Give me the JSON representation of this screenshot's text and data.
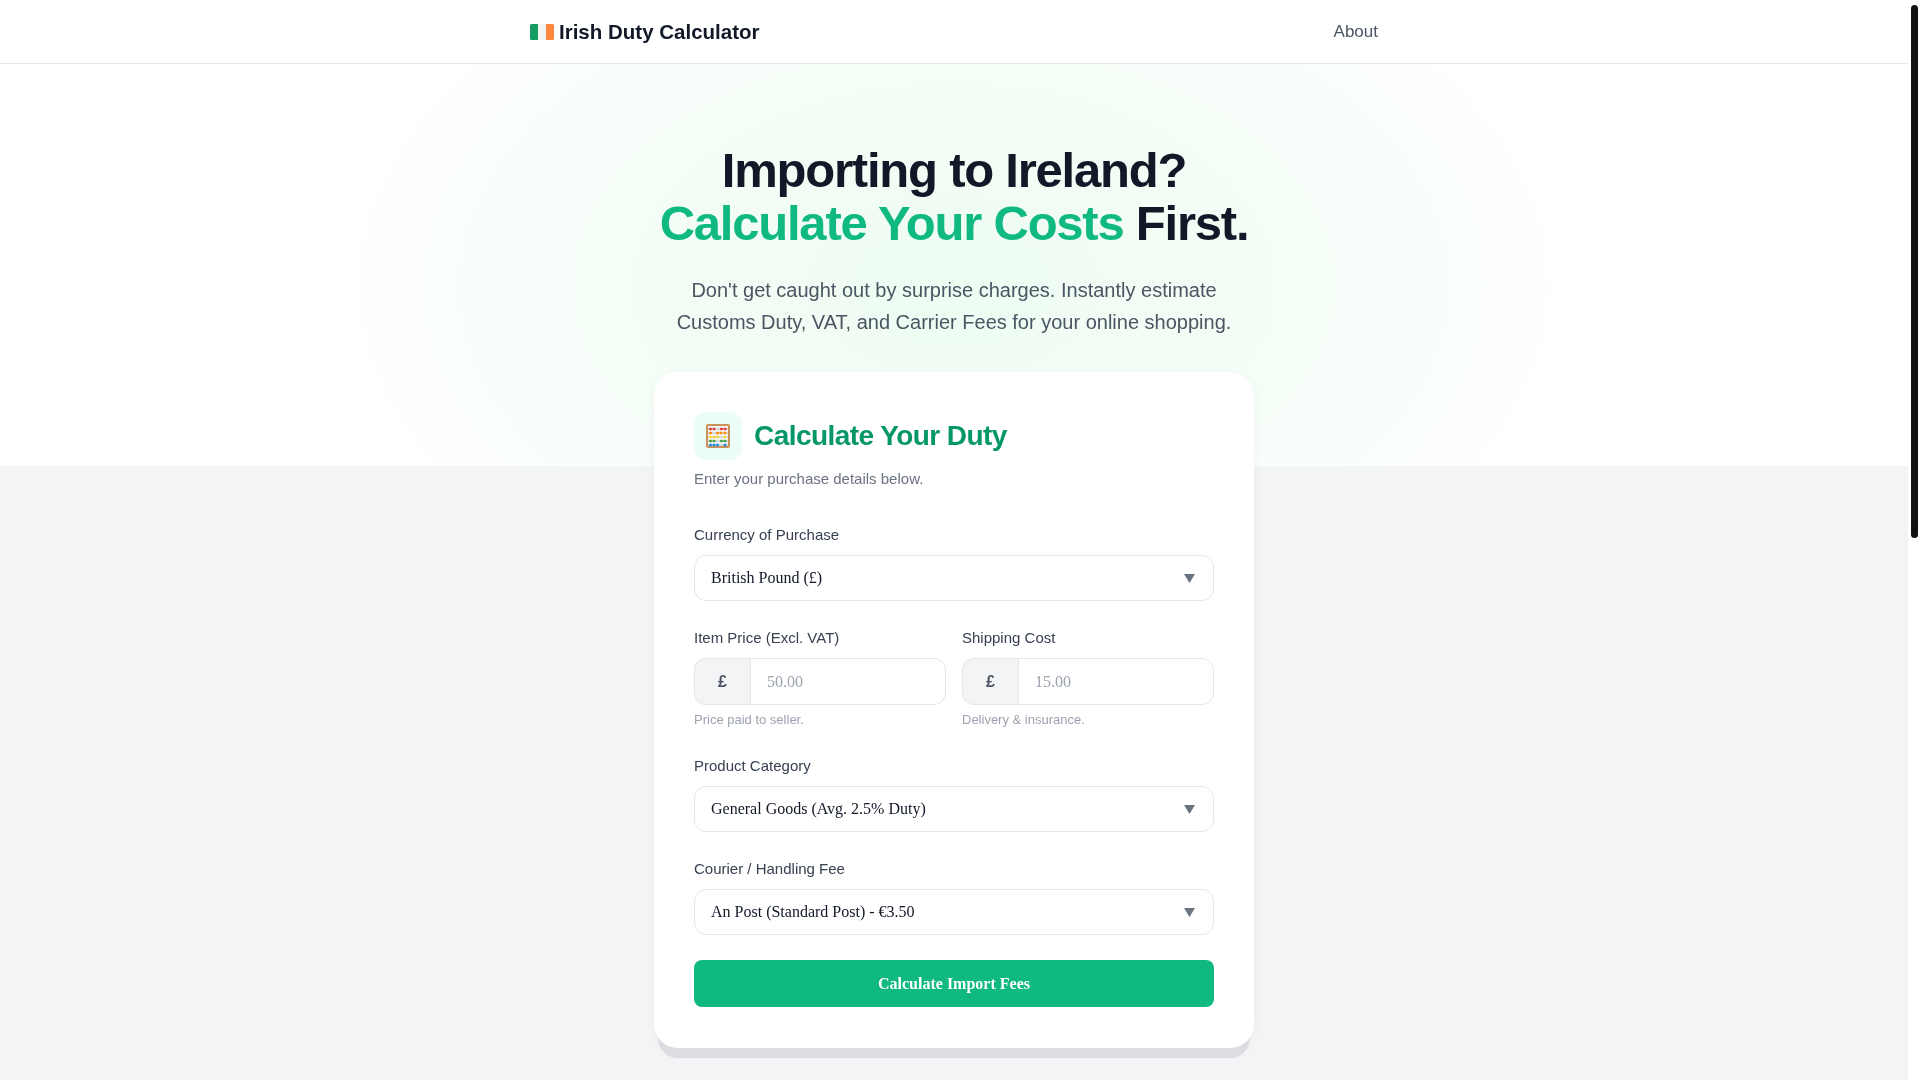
{
  "header": {
    "logo": "Irish Duty Calculator",
    "nav_link": "About"
  },
  "hero": {
    "title_line_1": "Importing to Ireland?",
    "title_highlight": "Calculate Your Costs",
    "title_rest": "First.",
    "subtitle": "Don't get caught out by surprise charges. Instantly estimate Customs Duty, VAT, and Carrier Fees for your online shopping."
  },
  "calculator": {
    "title": "Calculate Your Duty",
    "subtitle": "Enter your purchase details below.",
    "fields": [
      {
        "kind": "select",
        "label": "Currency of Purchase",
        "value": "British Pound (£)"
      },
      {
        "kind": "money_pair",
        "items": [
          {
            "label": "Item Price (Excl. VAT)",
            "prefix": "£",
            "placeholder": "50.00",
            "hint": "Price paid to seller."
          },
          {
            "label": "Shipping Cost",
            "prefix": "£",
            "placeholder": "15.00",
            "hint": "Delivery & insurance."
          }
        ]
      },
      {
        "kind": "select",
        "label": "Product Category",
        "value": "General Goods (Avg. 2.5% Duty)"
      },
      {
        "kind": "select",
        "label": "Courier / Handling Fee",
        "value": "An Post (Standard Post) - €3.50"
      }
    ],
    "submit_button": "Calculate Import Fees"
  }
}
